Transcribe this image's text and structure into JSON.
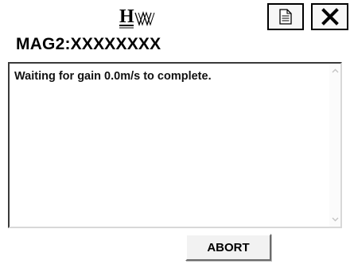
{
  "header": {
    "device_title": "MAG2:XXXXXXXX"
  },
  "toolbar": {
    "log_icon": "document-icon",
    "close_icon": "close-icon"
  },
  "message": {
    "text": "Waiting for gain 0.0m/s to complete."
  },
  "actions": {
    "abort_label": "ABORT"
  }
}
